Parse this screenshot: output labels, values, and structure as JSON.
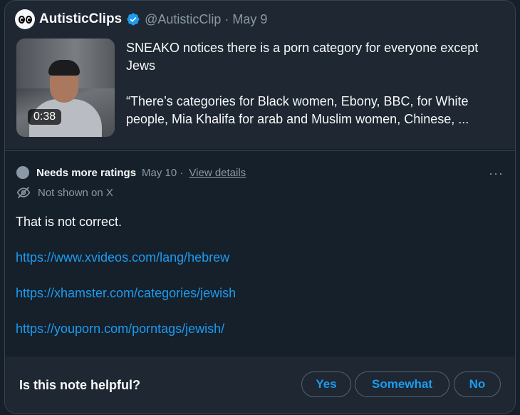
{
  "tweet": {
    "display_name": "AutisticClips",
    "handle_and_date": "@AutisticClip · May 9",
    "video_duration": "0:38",
    "text_line1": "SNEAKO notices there is a porn category for everyone except Jews",
    "text_line2": "“There’s categories for Black women, Ebony, BBC, for White people, Mia Khalifa for arab and Muslim women, Chinese, ..."
  },
  "note": {
    "status": "Needs more ratings",
    "date": "May 10 ·",
    "view_details": "View details",
    "more": "···",
    "visibility": "Not shown on X",
    "body": "That is not correct.",
    "links": [
      "https://www.xvideos.com/lang/hebrew",
      "https://xhamster.com/categories/jewish",
      "https://youporn.com/porntags/jewish/"
    ]
  },
  "rating": {
    "question": "Is this note helpful?",
    "yes": "Yes",
    "somewhat": "Somewhat",
    "no": "No"
  },
  "colors": {
    "accent": "#1d9bf0",
    "background": "#15202b",
    "muted": "#8b98a5"
  },
  "icons": [
    "verified-badge-icon",
    "eye-off-icon",
    "more-icon"
  ]
}
